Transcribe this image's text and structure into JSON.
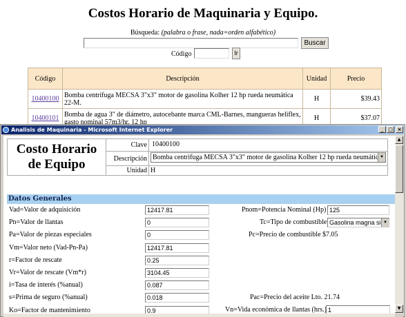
{
  "page": {
    "title": "Costos Horario de Maquinaria y Equipo.",
    "search_label": "Búsqueda:",
    "search_hint": "(palabra o frase, nada=orden alfabético)",
    "search_value": "",
    "search_button": "Buscar",
    "codigo_label": "Código",
    "codigo_value": "",
    "ir_button": "Ir"
  },
  "results": {
    "headers": [
      "Código",
      "Descripción",
      "Unidad",
      "Precio"
    ],
    "rows": [
      {
        "code": "10400100",
        "desc": "Bomba centrífuga MECSA 3\"x3\" motor de gasolina Kolher 12 hp rueda neumática 22-M.",
        "unit": "H",
        "price": "$39.43"
      },
      {
        "code": "10400101",
        "desc": "Bomba de agua 3\" de diámetro, autocebante marca CML-Barnes, mangueras heliflex, gasto nominal 57m3/hr. 12 hp",
        "unit": "H",
        "price": "$37.07"
      }
    ]
  },
  "window": {
    "title": "Analisis de Maquinaria - Microsoft Internet Explorer",
    "heading": "Costo Horario de Equipo",
    "clave_label": "Clave",
    "clave_value": "10400100",
    "descripcion_label": "Descripción",
    "descripcion_value": "Bomba centrifuga MECSA 3\"x3\" motor de gasolina Kolher 12 hp rueda neumática 22-M",
    "unidad_label": "Unidad",
    "unidad_value": "H",
    "section": "Datos Generales",
    "left_fields": [
      {
        "label": "Vad=Valor de adquisición",
        "value": "12417.81"
      },
      {
        "label": "Pn=Valor de llantas",
        "value": "0"
      },
      {
        "label": "Pa=Valor de piezas especiales",
        "value": "0"
      },
      {
        "label": "Vm=Valor neto (Vad-Pn-Pa)",
        "value": "12417.81"
      },
      {
        "label": "r=Factor de rescate",
        "value": "0.25"
      },
      {
        "label": "Vr=Valor de rescate (Vm*r)",
        "value": "3104.45"
      },
      {
        "label": "i=Tasa de interés (%anual)",
        "value": "0.087"
      },
      {
        "label": "s=Prima de seguro (%anual)",
        "value": "0.018"
      },
      {
        "label": "Ko=Factor de mantenimiento",
        "value": "0.9"
      }
    ],
    "pnom_label": "Pnom=Potencia Nominal (Hp)",
    "pnom_value": "125",
    "tc_label": "Tc=Tipo de combustible",
    "tc_value": "Gasolina magna sin...",
    "pc_text": "Pc=Precio de combustible $7.05",
    "pac_text": "Pac=Precio del aceite Lto. 21.74",
    "vn_label": "Vn=Vida económica de llantas (hrs.)",
    "vn_value": "1"
  }
}
